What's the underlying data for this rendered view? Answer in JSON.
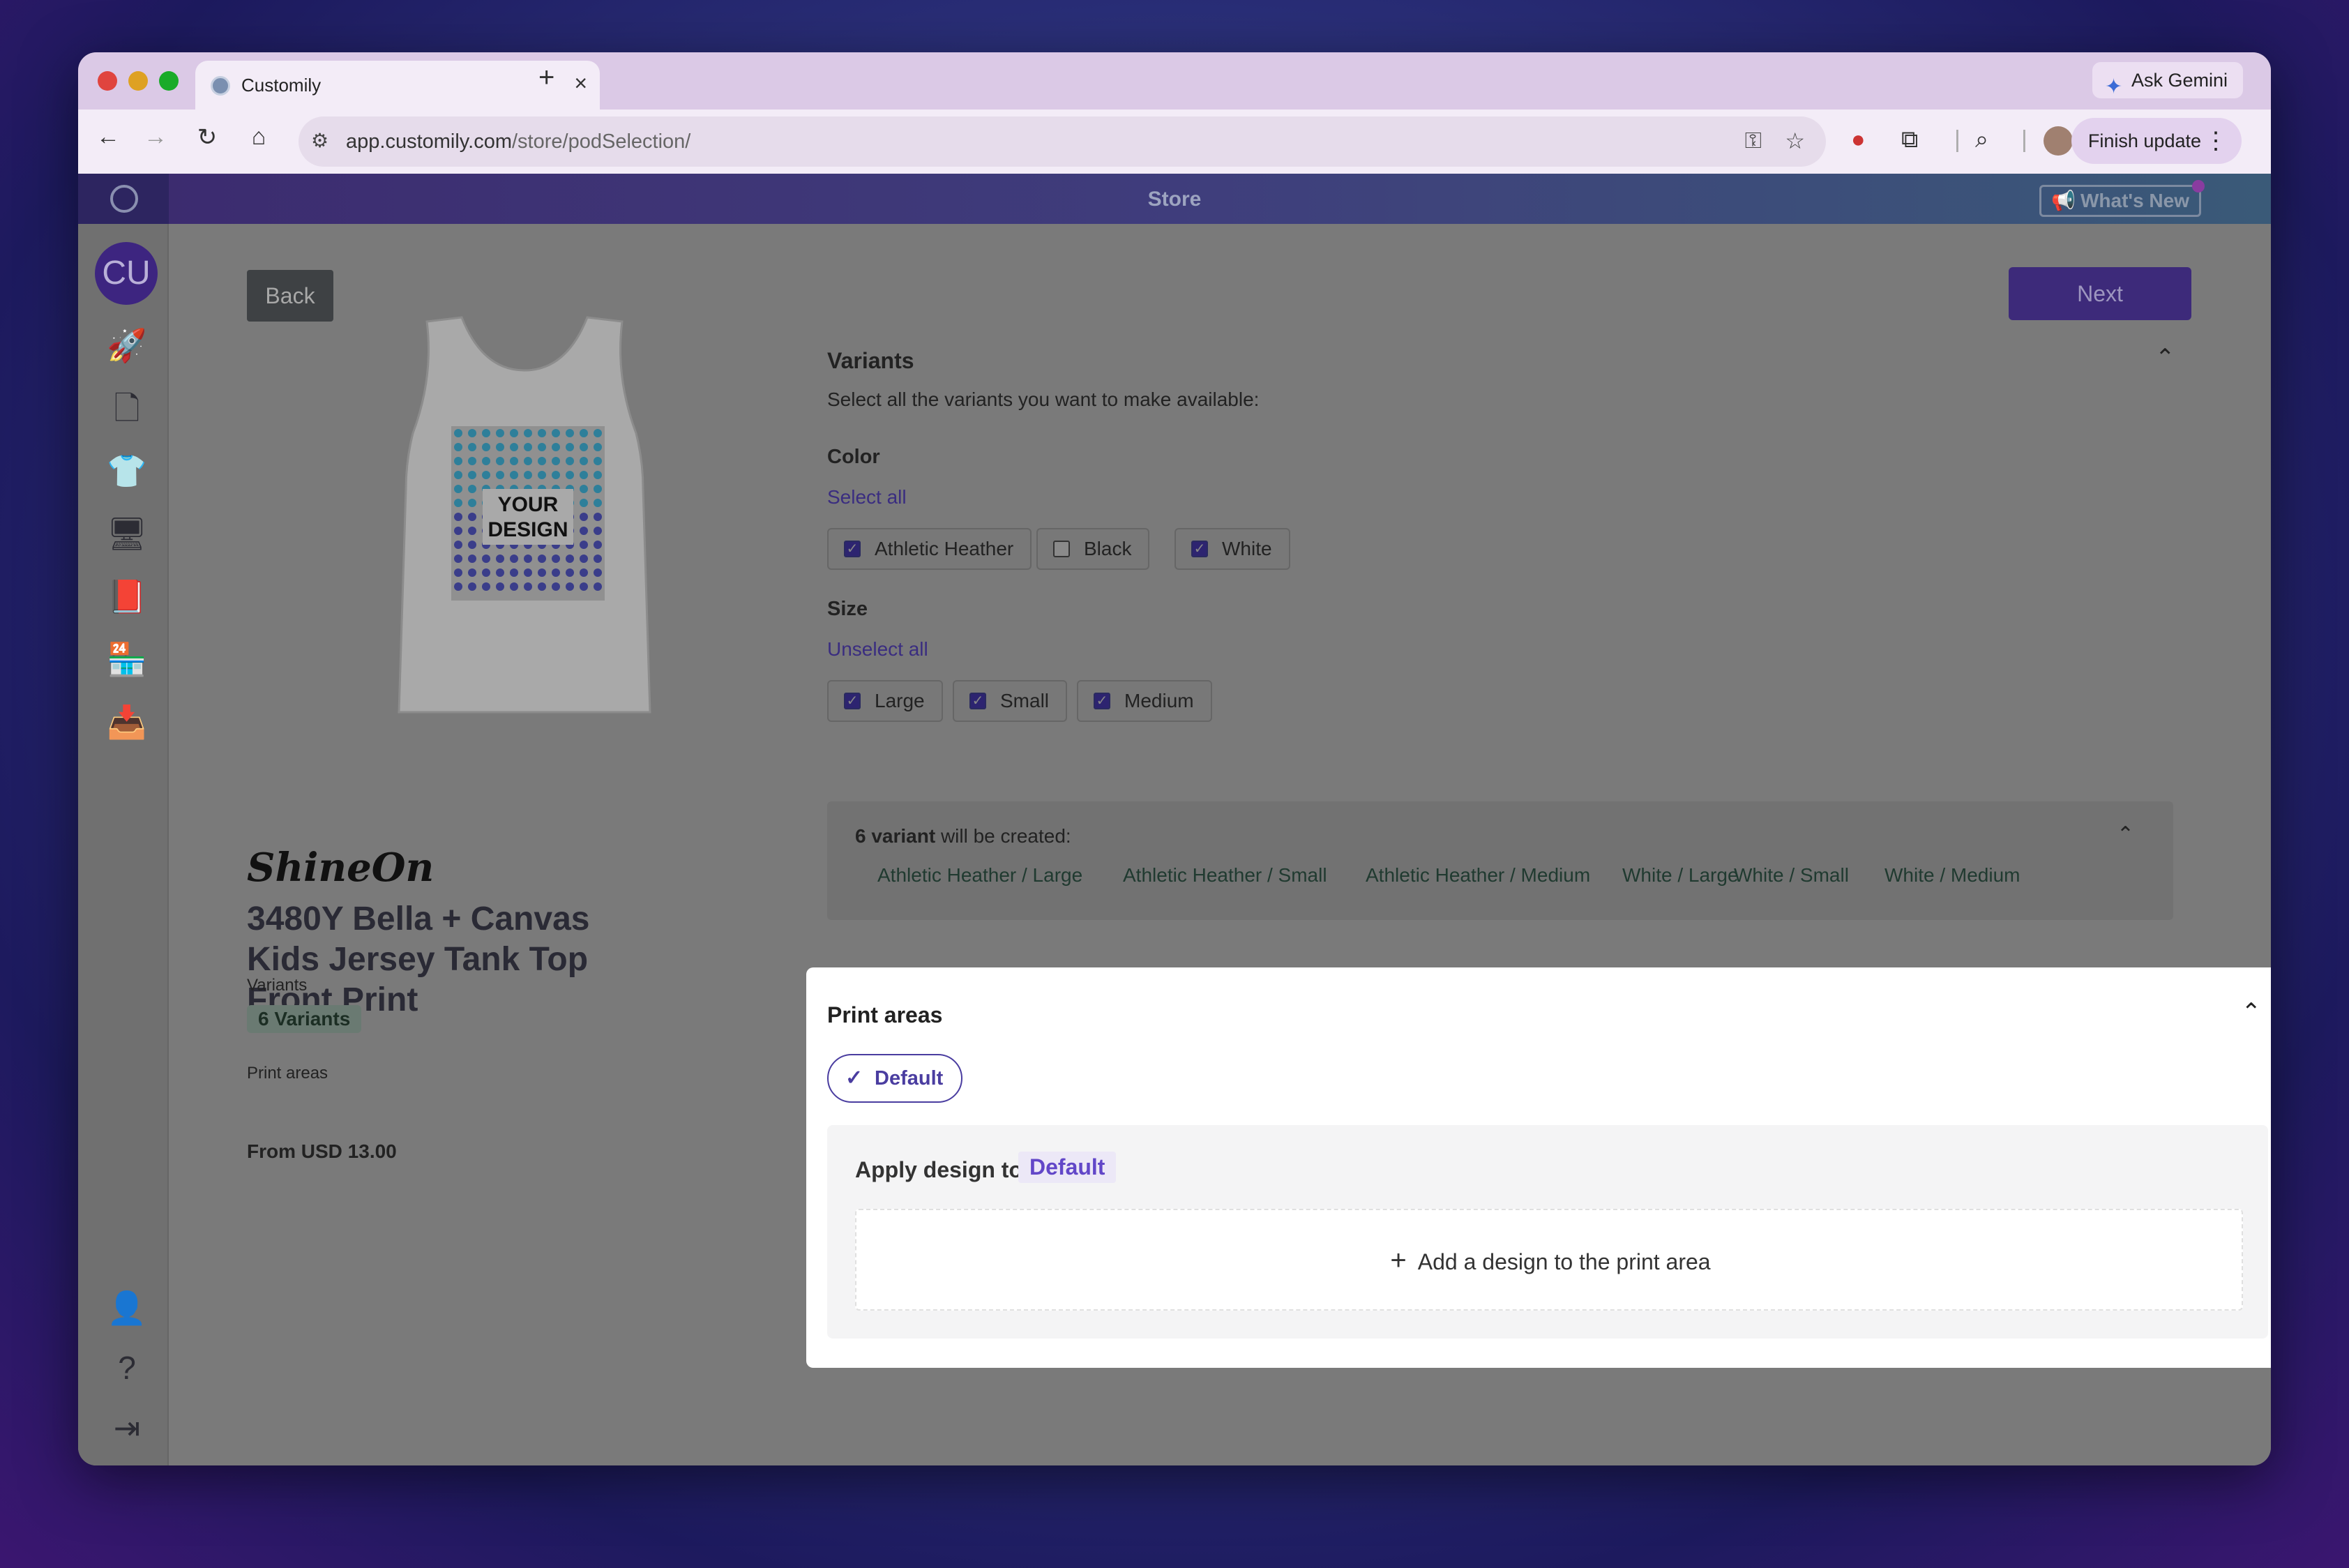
{
  "browser": {
    "tab_title": "Customily",
    "tab_close": "×",
    "new_tab": "+",
    "ask_gemini": "Ask Gemini",
    "url_host": "app.customily.com",
    "url_path": "/store/podSelection/",
    "finish_update": "Finish update"
  },
  "app": {
    "header_title": "Store",
    "whats_new": "What's New",
    "user_initials": "CU",
    "back_label": "Back",
    "next_label": "Next"
  },
  "product": {
    "brand": "ShineOn",
    "title": "3480Y Bella + Canvas Kids Jersey Tank Top Front Print",
    "variants_label": "Variants",
    "variants_badge": "6 Variants",
    "print_areas_label": "Print areas",
    "price": "From USD 13.00",
    "design_text_line1": "YOUR",
    "design_text_line2": "DESIGN"
  },
  "variants": {
    "title": "Variants",
    "description": "Select all the variants you want to make available:",
    "color_label": "Color",
    "color_action": "Select all",
    "colors": [
      {
        "label": "Athletic Heather",
        "checked": true
      },
      {
        "label": "Black",
        "checked": false
      },
      {
        "label": "White",
        "checked": true
      }
    ],
    "size_label": "Size",
    "size_action": "Unselect all",
    "sizes": [
      {
        "label": "Large",
        "checked": true
      },
      {
        "label": "Small",
        "checked": true
      },
      {
        "label": "Medium",
        "checked": true
      }
    ],
    "summary_count": "6 variant",
    "summary_rest": " will be created:",
    "created": [
      "Athletic Heather / Large",
      "Athletic Heather / Small",
      "Athletic Heather / Medium",
      "White / Large",
      "White / Small",
      "White / Medium"
    ]
  },
  "print_areas": {
    "title": "Print areas",
    "default_pill": "Default",
    "apply_label": "Apply design to",
    "apply_tag": "Default",
    "add_design": "Add a design to the print area"
  },
  "colors": {
    "accent": "#4a3da0",
    "brand_purple": "#3d2a7a",
    "tag_text": "#6247c8"
  }
}
